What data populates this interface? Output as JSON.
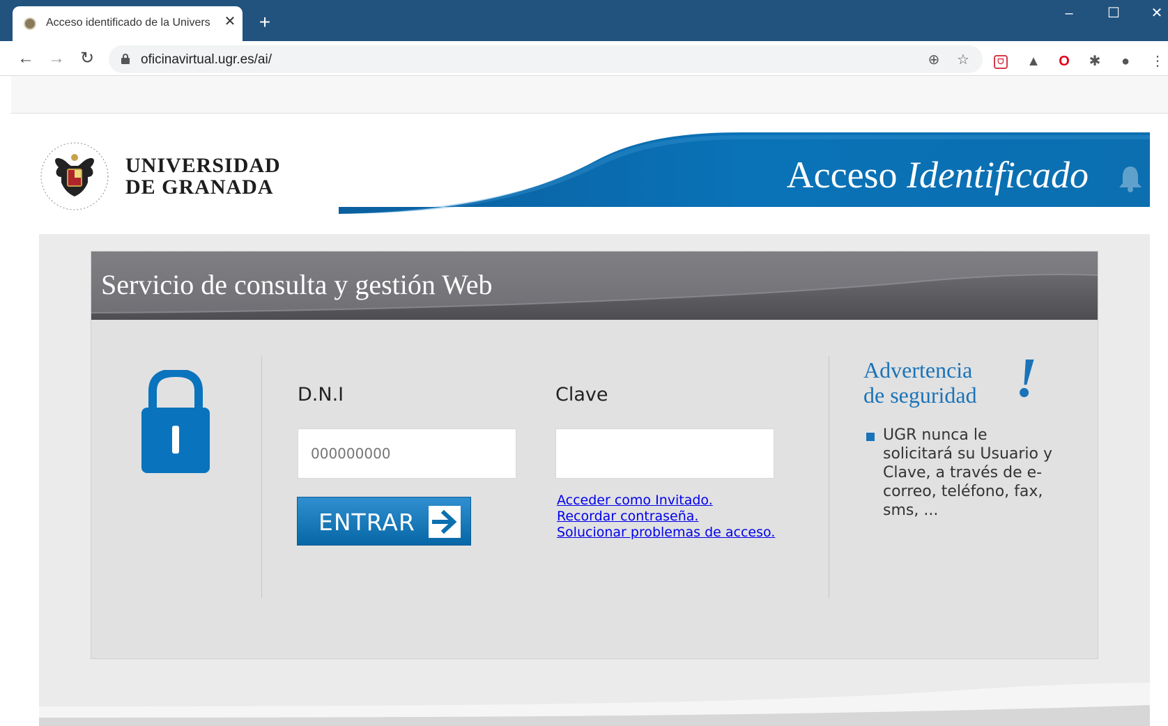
{
  "browser": {
    "tab_title": "Acceso identificado de la Univers",
    "tab_close": "✕",
    "new_tab": "+",
    "window_controls": {
      "minimize": "–",
      "maximize": "☐",
      "close": "✕"
    },
    "nav": {
      "back": "←",
      "forward": "→",
      "reload": "↻"
    },
    "url": "oficinavirtual.ugr.es/ai/",
    "omnibox_icons": {
      "zoom": "⊕",
      "star": "☆"
    },
    "extensions": {
      "pocket": "ᗜ",
      "drive": "▲",
      "opera": "O",
      "puzzle": "✱",
      "profile": "●",
      "menu": "⋮"
    }
  },
  "header": {
    "logo_line1": "UNIVERSIDAD",
    "logo_line2": "DE GRANADA",
    "banner_title_plain": "Acceso ",
    "banner_title_italic": "Identificado"
  },
  "panel": {
    "title": "Servicio de consulta y gestión Web",
    "dni_label": "D.N.I",
    "dni_placeholder": "000000000",
    "clave_label": "Clave",
    "clave_value": "",
    "submit_label": "ENTRAR",
    "links": {
      "guest": "Acceder como Invitado.",
      "remember": "Recordar contraseña.",
      "troubleshoot": "Solucionar problemas de acceso."
    },
    "warning": {
      "title_line1": "Advertencia",
      "title_line2": "de seguridad",
      "mark": "!",
      "text": "UGR nunca le solicitará su Usuario y Clave, a través de e-correo, teléfono, fax, sms, ..."
    }
  },
  "colors": {
    "chrome_titlebar": "#22527e",
    "ugr_blue": "#0b6fb0",
    "warning_blue": "#1a73b8",
    "panel_head_gray": "#7b7b80"
  }
}
